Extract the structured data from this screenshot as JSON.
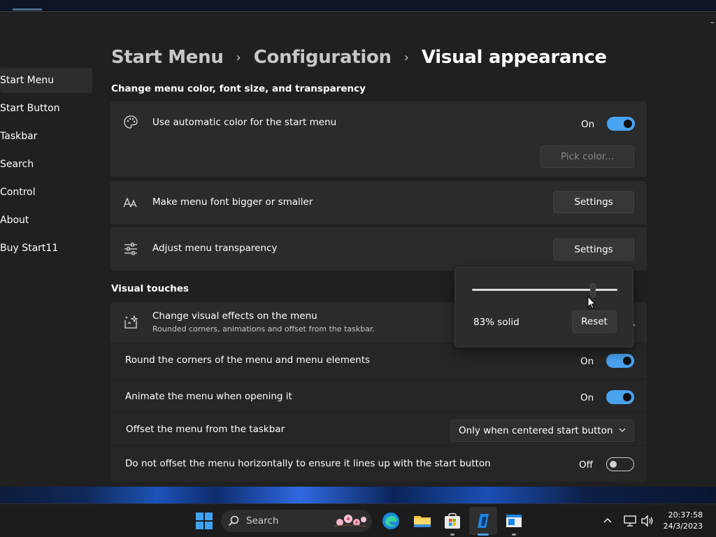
{
  "breadcrumb": {
    "crumb1": "Start Menu",
    "crumb2": "Configuration",
    "current": "Visual appearance",
    "separator": "›"
  },
  "sidebar": {
    "items": [
      {
        "label": "Start Menu"
      },
      {
        "label": "Start Button"
      },
      {
        "label": "Taskbar"
      },
      {
        "label": "Search"
      },
      {
        "label": "Control"
      },
      {
        "label": "About"
      },
      {
        "label": "Buy Start11"
      }
    ]
  },
  "section1": {
    "title": "Change menu color, font size, and transparency"
  },
  "auto_color": {
    "label": "Use automatic color for the start menu",
    "state": "On",
    "pick_label": "Pick color..."
  },
  "font_size": {
    "label": "Make menu font bigger or smaller",
    "button": "Settings"
  },
  "transparency": {
    "label": "Adjust menu transparency",
    "button": "Settings"
  },
  "flyout": {
    "value_text": "83% solid",
    "reset_label": "Reset",
    "level_percent": 83
  },
  "section2": {
    "title": "Visual touches"
  },
  "visual_effects": {
    "label": "Change visual effects on the menu",
    "sublabel": "Rounded corners, animations and offset from the taskbar."
  },
  "settings_rows": [
    {
      "label": "Round the corners of the menu and menu elements",
      "state": "On"
    },
    {
      "label": "Animate the menu when opening it",
      "state": "On"
    },
    {
      "label": "Offset the menu from the taskbar",
      "selected": "Only when centered start button"
    },
    {
      "label": "Do not offset the menu horizontally to ensure it lines up with the start button",
      "state": "Off"
    }
  ],
  "taskbar": {
    "search_label": "Search",
    "time": "20:37:58",
    "date": "24/3/2023"
  },
  "colors": {
    "accent": "#4aa3ef",
    "window_bg": "#202020",
    "card_bg": "#2b2b2b",
    "taskbar_bg": "#1c1c1c"
  }
}
